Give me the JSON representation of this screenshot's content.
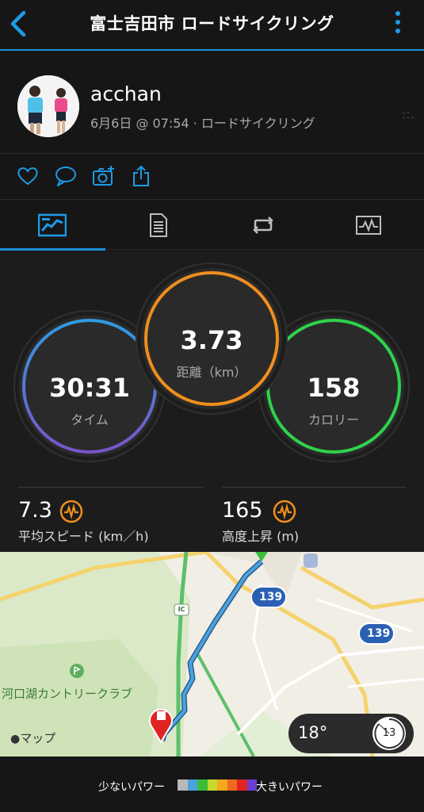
{
  "header": {
    "title": "富士吉田市 ロードサイクリング"
  },
  "profile": {
    "username": "acchan",
    "subline": "6月6日 @ 07:54 · ロードサイクリング"
  },
  "stats": {
    "distance": {
      "value": "3.73",
      "label": "距離（km）"
    },
    "time": {
      "value": "30:31",
      "label": "タイム"
    },
    "calories": {
      "value": "158",
      "label": "カロリー"
    }
  },
  "metrics": {
    "speed": {
      "value": "7.3",
      "label": "平均スピード (km／h)"
    },
    "elevation": {
      "value": "165",
      "label": "高度上昇 (m)"
    }
  },
  "map": {
    "place_label": "河口湖カントリークラブ",
    "attribution": "マップ",
    "route_badge_1": "139",
    "route_badge_2": "139",
    "ic_label": "IC",
    "weather": {
      "temp": "18°",
      "wind": "13"
    }
  },
  "legend": {
    "low_label": "少ないパワー",
    "high_label": "大きいパワー",
    "colors": [
      "#b9b9b9",
      "#4aa3e0",
      "#3bbd3b",
      "#c7d82c",
      "#f1a81e",
      "#ef6a1c",
      "#e02424",
      "#6a3fd0"
    ]
  },
  "colors": {
    "accent": "#1d8fd6",
    "distance_ring": "#ef8e1e",
    "calories_ring": "#2ed24a",
    "time_ring_start": "#2f9be0",
    "time_ring_end": "#7a55c8"
  }
}
